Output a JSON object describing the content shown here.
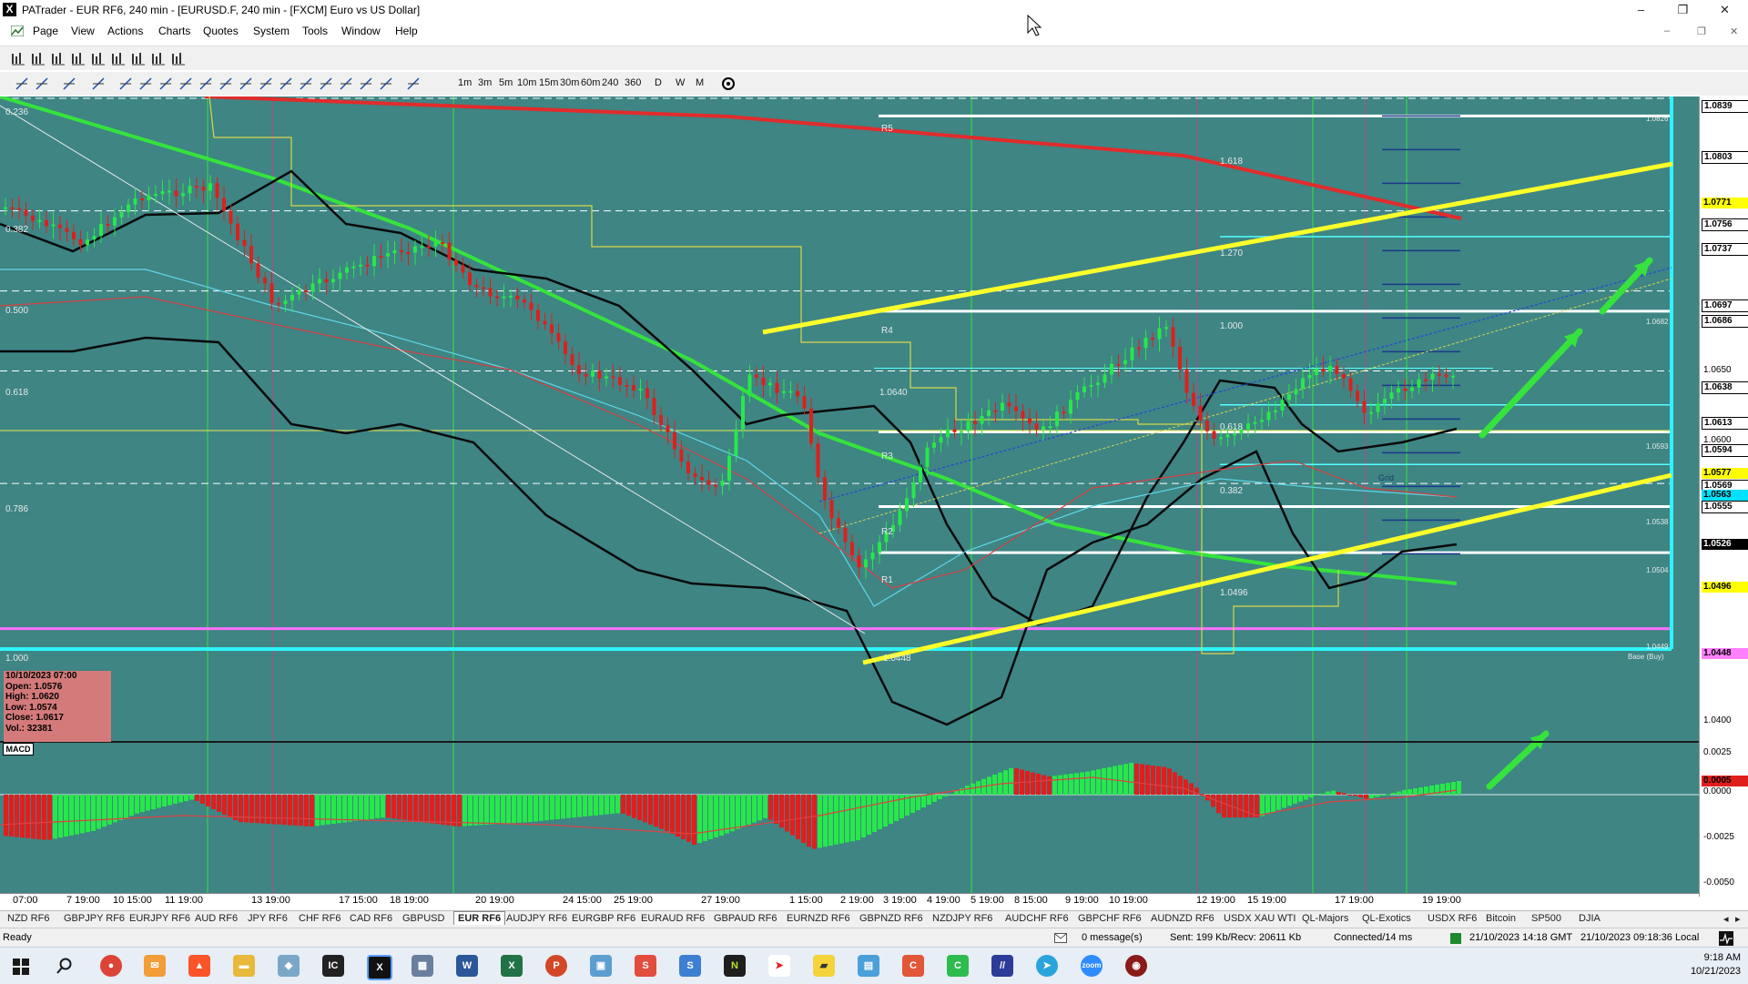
{
  "window": {
    "title": "PATrader - EUR RF6, 240 min - [EURUSD.F, 240 min - [FXCM] Euro vs US Dollar]",
    "app_icon": "X",
    "min_label": "–",
    "max_label": "❐",
    "close_label": "✕"
  },
  "menu": [
    "Page",
    "View",
    "Actions",
    "Charts",
    "Quotes",
    "System",
    "Tools",
    "Window",
    "Help"
  ],
  "timeframes": [
    "1m",
    "3m",
    "5m",
    "10m",
    "15m",
    "30m",
    "60m",
    "240",
    "360",
    "D",
    "W",
    "M"
  ],
  "price_labels": {
    "p1": "1.0839",
    "p2": "1.0803",
    "p3": "1.0771",
    "p4": "1.0756",
    "p5": "1.0737",
    "p6": "1.0697",
    "p7": "1.0686",
    "p8": "1.0650",
    "p9": "1.0638",
    "p10": "1.0613",
    "p11": "1.0600",
    "p12": "1.0594",
    "p13": "1.0577",
    "p14": "1.0569",
    "p15": "1.0563",
    "p16": "1.0555",
    "p17": "1.0526",
    "p18": "1.0496",
    "p19": "1.0448",
    "p20": "1.0400",
    "m1": "0.0025",
    "m2": "0.0005",
    "m3": "0.0000",
    "m4": "-0.0025",
    "m5": "-0.0050"
  },
  "fib_left": [
    "0.236",
    "0.382",
    "0.500",
    "0.618",
    "0.786",
    "1.000"
  ],
  "levels": {
    "R5": "R5",
    "R4": "R4",
    "R3": "R3",
    "R2": "R2",
    "R1": "R1",
    "fib1618": "1.618",
    "fib1270": "1.270",
    "fib1000": "1.000",
    "fib0618": "0.618",
    "fib0382": "0.382",
    "lv1": "1.0640",
    "lv2": "1.0496",
    "lv3": "1.0448",
    "r5v": "1.0826",
    "r4v": "1.0682",
    "r3v": "1.0593",
    "r2v": "1.0538",
    "r1v": "1.0504",
    "bv": "1.0449",
    "base": "Base (Buy)",
    "grid": "Grid"
  },
  "info": {
    "date": "10/10/2023 07:00",
    "open": "Open: 1.0576",
    "high": "High: 1.0620",
    "low": "Low: 1.0574",
    "close": "Close: 1.0617",
    "vol": "Vol.: 32381"
  },
  "macd_label": "MACD",
  "time_labels": [
    "07:00",
    "7 19:00",
    "10 15:00",
    "11 19:00",
    "13 19:00",
    "17 15:00",
    "18 19:00",
    "20 19:00",
    "24 15:00",
    "25 19:00",
    "27 19:00",
    "1 15:00",
    "2 19:00",
    "3 19:00",
    "4 19:00",
    "5 19:00",
    "8 15:00",
    "9 19:00",
    "10 19:00",
    "12 19:00",
    "15 19:00",
    "17 19:00",
    "19 19:00"
  ],
  "symbol_tabs": [
    "NZD RF6",
    "GBPJPY RF6",
    "EURJPY RF6",
    "AUD RF6",
    "JPY RF6",
    "CHF RF6",
    "CAD RF6",
    "GBPUSD",
    "EUR RF6",
    "AUDJPY RF6",
    "EURGBP RF6",
    "EURAUD RF6",
    "GBPAUD RF6",
    "EURNZD RF6",
    "GBPNZD RF6",
    "NZDJPY RF6",
    "AUDCHF RF6",
    "GBPCHF RF6",
    "AUDNZD RF6",
    "USDX XAU WTI",
    "QL-Majors",
    "QL-Exotics",
    "USDX RF6",
    "Bitcoin",
    "SP500",
    "DJIA"
  ],
  "active_tab": "EUR RF6",
  "status": {
    "ready": "Ready",
    "messages": "0 message(s)",
    "traffic": "Sent: 199 Kb/Recv: 20611 Kb",
    "connection": "Connected/14 ms",
    "gmt": "21/10/2023 14:18 GMT",
    "local": "21/10/2023 09:18:36 Local"
  },
  "clock": {
    "time": "9:18 AM",
    "date": "10/21/2023"
  },
  "colors": {
    "chart_bg": "#3e8584",
    "bull": "#27e84a",
    "bear": "#e01e1e",
    "trend": "#ffff2a",
    "arrow": "#35e33c"
  }
}
